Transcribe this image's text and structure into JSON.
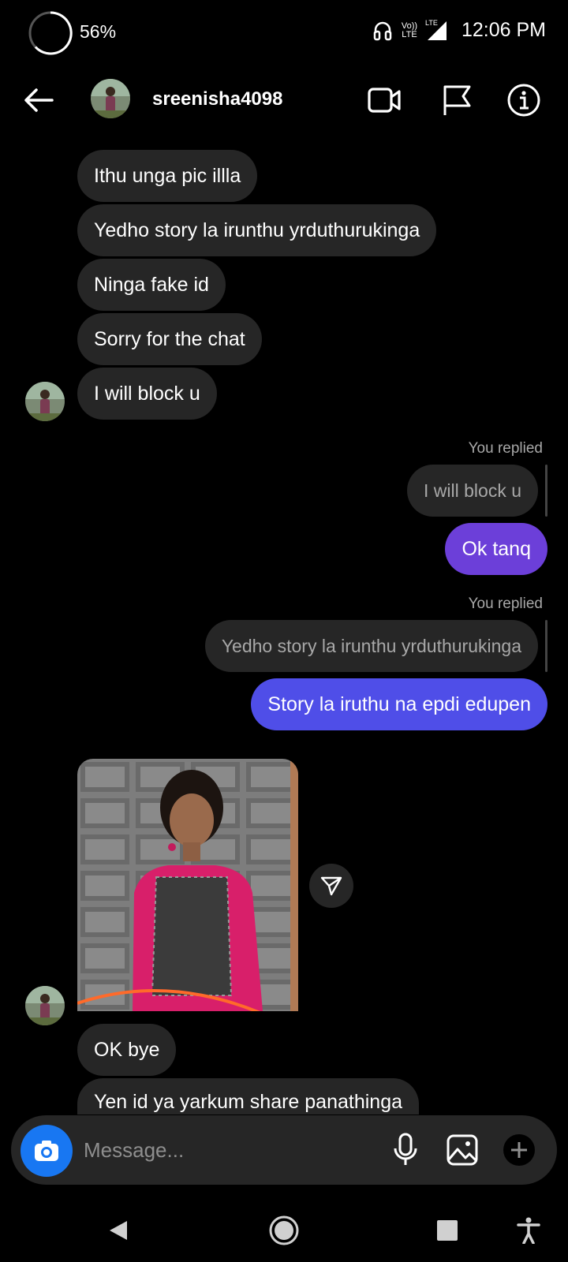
{
  "status_bar": {
    "battery_percent": "56%",
    "network": "Vo)) LTE",
    "signal_label": "LTE",
    "time": "12:06 PM"
  },
  "header": {
    "username": "sreenisha4098",
    "icons": [
      "back-arrow-icon",
      "video-call-icon",
      "flag-icon",
      "info-icon"
    ]
  },
  "messages": {
    "m1": "Ithu unga pic illla",
    "m2": "Yedho story la irunthu yrduthurukinga",
    "m3": "Ninga fake id",
    "m4": "Sorry for the chat",
    "m5": "I will block u",
    "reply1": {
      "label": "You replied",
      "quoted": "I will block u",
      "text": "Ok tanq"
    },
    "reply2": {
      "label": "You replied",
      "quoted": "Yedho story la irunthu yrduthurukinga",
      "text": "Story la iruthu na epdi edupen"
    },
    "m6": "OK bye",
    "m7": "Yen id ya yarkum share panathinga"
  },
  "composer": {
    "placeholder": "Message..."
  },
  "colors": {
    "incoming_bubble": "#262626",
    "outgoing_purple": "#6c3fd9",
    "outgoing_blue": "#4f4ee8",
    "camera_blue": "#1877f2"
  }
}
